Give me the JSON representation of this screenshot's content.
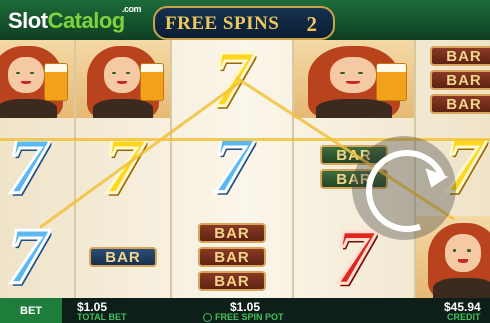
{
  "watermark": {
    "part1": "Slot",
    "part2": "Catalog",
    "part3": ".com"
  },
  "banner": {
    "title": "FREE SPINS",
    "count": "2"
  },
  "reels": [
    {
      "name": "reel-1",
      "symbols": [
        "woman",
        "seven-blue",
        "seven-blue"
      ]
    },
    {
      "name": "reel-2",
      "symbols": [
        "woman",
        "seven-yellow",
        "bar-single"
      ]
    },
    {
      "name": "reel-3",
      "symbols": [
        "seven-yellow",
        "seven-blue",
        "bar-triple"
      ]
    },
    {
      "name": "reel-4",
      "symbols": [
        "woman",
        "bar-double",
        "seven-red"
      ]
    },
    {
      "name": "reel-5",
      "symbols": [
        "bar-triple",
        "seven-yellow",
        "woman"
      ]
    }
  ],
  "bar_label": "BAR",
  "spin_icon": "spin-refresh-icon",
  "colors": {
    "payline": "#f0c13a",
    "accent_green": "#43c25c",
    "gold": "#f0c75e"
  },
  "footer": {
    "bet_tab": "BET",
    "total_bet_value": "$1.05",
    "total_bet_label": "TOTAL BET",
    "free_spin_pot_value": "$1.05",
    "free_spin_pot_label": "FREE SPIN POT",
    "credit_value": "$45.94",
    "credit_label": "CREDIT"
  }
}
